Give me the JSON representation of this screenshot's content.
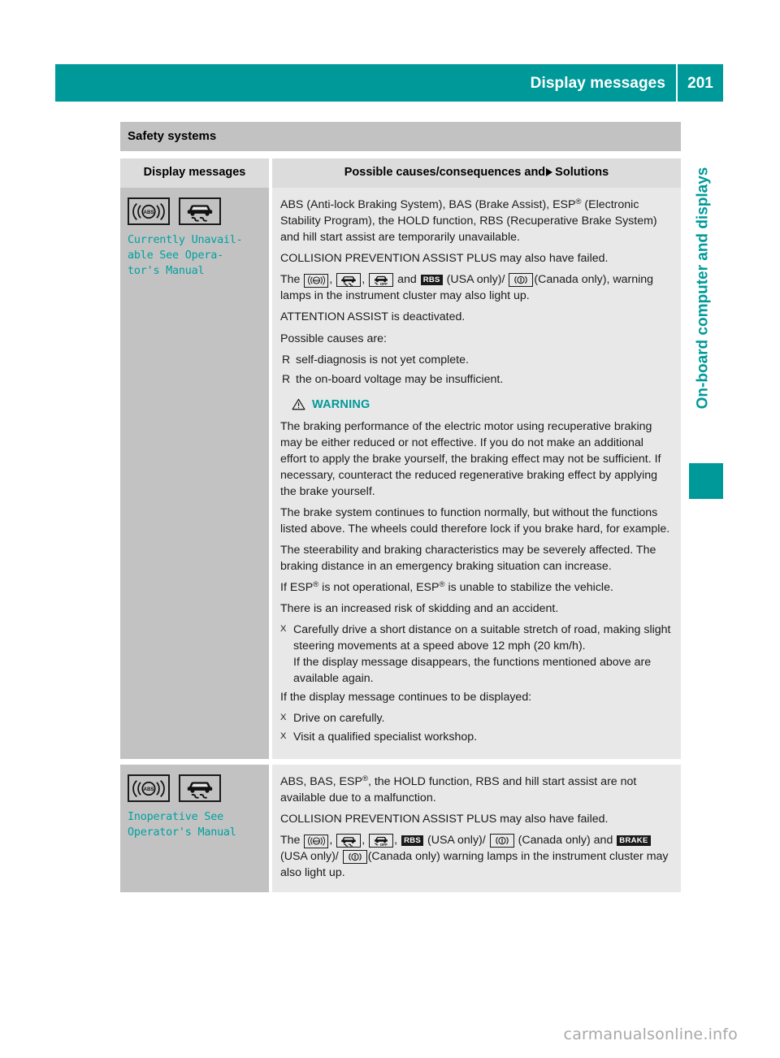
{
  "header": {
    "title": "Display messages",
    "page_number": "201"
  },
  "side_tab": {
    "label": "On-board computer and displays"
  },
  "section": {
    "title": "Safety systems"
  },
  "table": {
    "columns": {
      "left": "Display messages",
      "right_prefix": "Possible causes/consequences and",
      "right_suffix": "Solutions"
    },
    "rows": [
      {
        "lamps": [
          "abs-warning-lamp-icon",
          "esp-skid-warning-lamp-icon"
        ],
        "message": "Currently Unavail-\nable See Opera-\ntor's Manual",
        "blocks": [
          {
            "type": "para",
            "runs": [
              {
                "t": "text",
                "v": "ABS (Anti-lock Braking System), BAS (Brake Assist), ESP"
              },
              {
                "t": "sup",
                "v": "®"
              },
              {
                "t": "text",
                "v": " (Electronic Stability Program), the HOLD function, RBS (Recuperative Brake System) and hill start assist are temporarily unavailable."
              }
            ]
          },
          {
            "type": "para",
            "runs": [
              {
                "t": "text",
                "v": "COLLISION PREVENTION ASSIST PLUS may also have failed."
              }
            ]
          },
          {
            "type": "para",
            "runs": [
              {
                "t": "text",
                "v": "The "
              },
              {
                "t": "icon",
                "v": "abs-lamp-icon"
              },
              {
                "t": "text",
                "v": ", "
              },
              {
                "t": "icon",
                "v": "esp-skid-lamp-icon"
              },
              {
                "t": "text",
                "v": ", "
              },
              {
                "t": "icon",
                "v": "esp-off-lamp-icon"
              },
              {
                "t": "text",
                "v": " and "
              },
              {
                "t": "badge",
                "v": "RBS"
              },
              {
                "t": "text",
                "v": " (USA only)/ "
              },
              {
                "t": "icon",
                "v": "brake-circle-lamp-icon"
              },
              {
                "t": "text",
                "v": "(Canada only), warning lamps in the instrument cluster may also light up."
              }
            ]
          },
          {
            "type": "para",
            "runs": [
              {
                "t": "text",
                "v": "ATTENTION ASSIST is deactivated."
              }
            ]
          },
          {
            "type": "para",
            "runs": [
              {
                "t": "text",
                "v": "Possible causes are:"
              }
            ]
          },
          {
            "type": "bullet",
            "mark": "R",
            "runs": [
              {
                "t": "text",
                "v": "self-diagnosis is not yet complete."
              }
            ]
          },
          {
            "type": "bullet",
            "mark": "R",
            "runs": [
              {
                "t": "text",
                "v": "the on-board voltage may be insufficient."
              }
            ]
          },
          {
            "type": "warning-head",
            "label": "WARNING"
          },
          {
            "type": "para",
            "runs": [
              {
                "t": "text",
                "v": "The braking performance of the electric motor using recuperative braking may be either reduced or not effective. If you do not make an additional effort to apply the brake yourself, the braking effect may not be sufficient. If necessary, counteract the reduced regenerative braking effect by applying the brake yourself."
              }
            ]
          },
          {
            "type": "para",
            "runs": [
              {
                "t": "text",
                "v": "The brake system continues to function normally, but without the functions listed above. The wheels could therefore lock if you brake hard, for example."
              }
            ]
          },
          {
            "type": "para",
            "runs": [
              {
                "t": "text",
                "v": "The steerability and braking characteristics may be severely affected. The braking distance in an emergency braking situation can increase."
              }
            ]
          },
          {
            "type": "para",
            "runs": [
              {
                "t": "text",
                "v": "If ESP"
              },
              {
                "t": "sup",
                "v": "®"
              },
              {
                "t": "text",
                "v": " is not operational, ESP"
              },
              {
                "t": "sup",
                "v": "®"
              },
              {
                "t": "text",
                "v": " is unable to stabilize the vehicle."
              }
            ]
          },
          {
            "type": "para",
            "runs": [
              {
                "t": "text",
                "v": "There is an increased risk of skidding and an accident."
              }
            ]
          },
          {
            "type": "step",
            "mark": "X",
            "runs": [
              {
                "t": "text",
                "v": "Carefully drive a short distance on a suitable stretch of road, making slight steering movements at a speed above 12 mph (20 km/h)."
              },
              {
                "t": "br",
                "v": ""
              },
              {
                "t": "text",
                "v": "If the display message disappears, the functions mentioned above are available again."
              }
            ]
          },
          {
            "type": "para",
            "runs": [
              {
                "t": "text",
                "v": "If the display message continues to be displayed:"
              }
            ]
          },
          {
            "type": "step",
            "mark": "X",
            "runs": [
              {
                "t": "text",
                "v": "Drive on carefully."
              }
            ]
          },
          {
            "type": "step",
            "mark": "X",
            "runs": [
              {
                "t": "text",
                "v": "Visit a qualified specialist workshop."
              }
            ]
          }
        ]
      },
      {
        "lamps": [
          "abs-warning-lamp-icon",
          "esp-skid-warning-lamp-icon"
        ],
        "message": "Inoperative See\nOperator's Manual",
        "blocks": [
          {
            "type": "para",
            "runs": [
              {
                "t": "text",
                "v": "ABS, BAS, ESP"
              },
              {
                "t": "sup",
                "v": "®"
              },
              {
                "t": "text",
                "v": ", the HOLD function, RBS and hill start assist are not available due to a malfunction."
              }
            ]
          },
          {
            "type": "para",
            "runs": [
              {
                "t": "text",
                "v": "COLLISION PREVENTION ASSIST PLUS may also have failed."
              }
            ]
          },
          {
            "type": "para",
            "runs": [
              {
                "t": "text",
                "v": "The "
              },
              {
                "t": "icon",
                "v": "abs-lamp-icon"
              },
              {
                "t": "text",
                "v": ", "
              },
              {
                "t": "icon",
                "v": "esp-skid-lamp-icon"
              },
              {
                "t": "text",
                "v": ", "
              },
              {
                "t": "icon",
                "v": "esp-off-lamp-icon"
              },
              {
                "t": "text",
                "v": ", "
              },
              {
                "t": "badge",
                "v": "RBS"
              },
              {
                "t": "text",
                "v": " (USA only)/ "
              },
              {
                "t": "icon",
                "v": "brake-circle-lamp-icon"
              },
              {
                "t": "text",
                "v": " (Canada only) and "
              },
              {
                "t": "badge",
                "v": "BRAKE"
              },
              {
                "t": "text",
                "v": "(USA only)/ "
              },
              {
                "t": "icon",
                "v": "brake-circle-lamp-icon"
              },
              {
                "t": "text",
                "v": "(Canada only) warning lamps in the instrument cluster may also light up."
              }
            ]
          }
        ]
      }
    ]
  },
  "footer": {
    "watermark": "carmanualsonline.info"
  },
  "colors": {
    "teal": "#009999",
    "message_teal": "#00a0a0",
    "section_gray": "#c2c2c2",
    "header_row_gray": "#dcdcdc",
    "body_gray": "#e8e8e8"
  }
}
